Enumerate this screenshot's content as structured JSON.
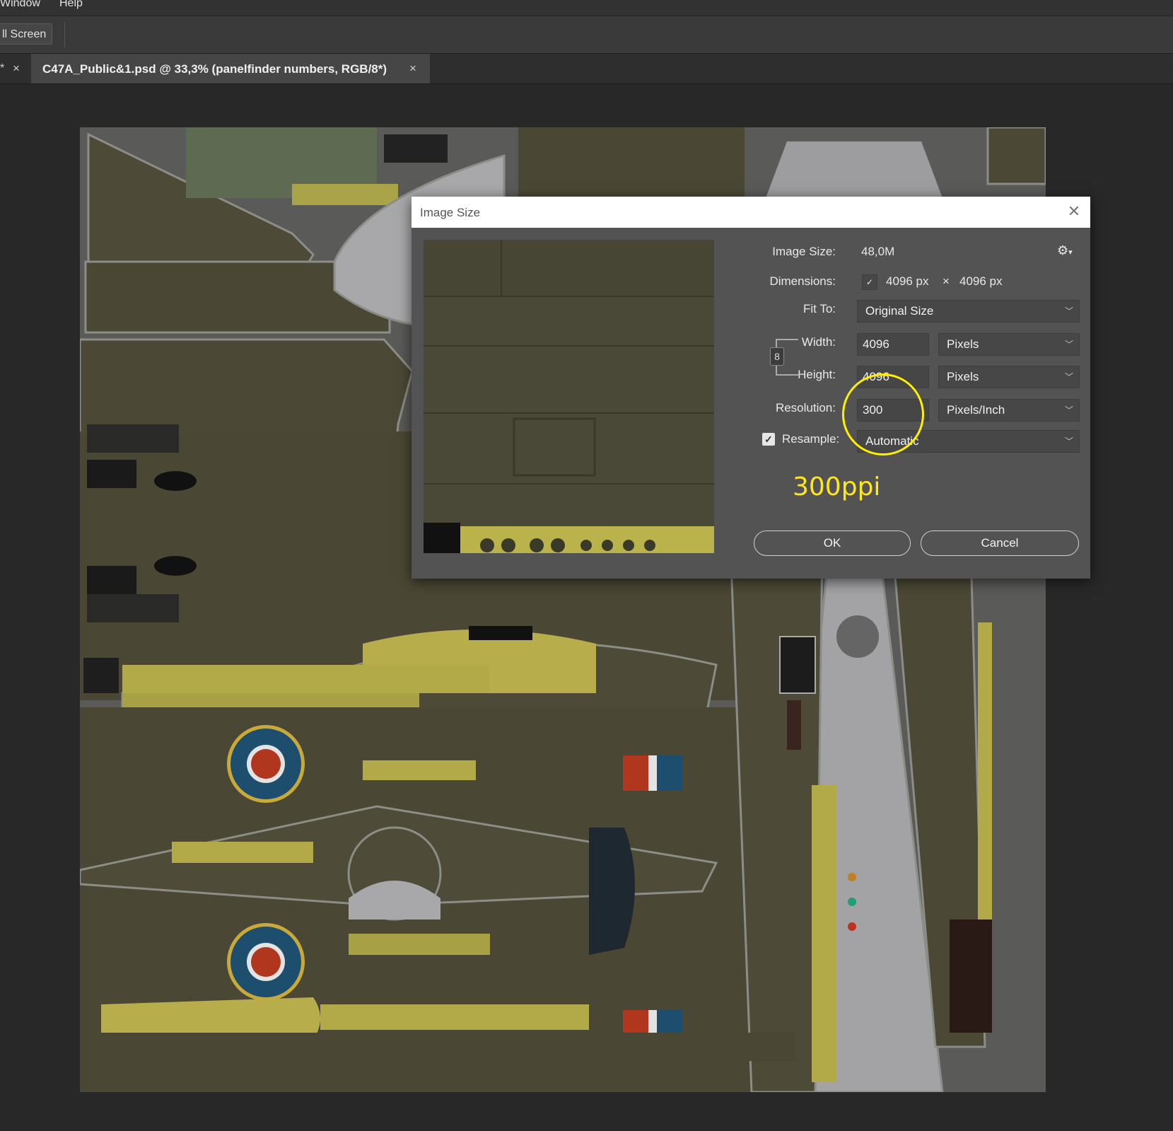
{
  "menu": {
    "items": [
      "Window",
      "Help"
    ]
  },
  "options_bar": {
    "full_screen_label": "ll Screen"
  },
  "tabs": {
    "prev_tab_marker": "*",
    "close_glyph": "×",
    "active_title": "C47A_Public&1.psd @ 33,3% (panelfinder numbers, RGB/8*)"
  },
  "dialog": {
    "title": "Image Size",
    "close_glyph": "✕",
    "image_size_label": "Image Size:",
    "image_size_value": "48,0M",
    "dimensions_label": "Dimensions:",
    "dimensions_width": "4096 px",
    "dimensions_times": "×",
    "dimensions_height": "4096 px",
    "fit_to_label": "Fit To:",
    "fit_to_value": "Original Size",
    "width_label": "Width:",
    "width_value": "4096",
    "width_unit": "Pixels",
    "height_label": "Height:",
    "height_value": "4096",
    "height_unit": "Pixels",
    "resolution_label": "Resolution:",
    "resolution_value": "300",
    "resolution_unit": "Pixels/Inch",
    "resample_label": "Resample:",
    "resample_checked": true,
    "resample_value": "Automatic",
    "ok_label": "OK",
    "cancel_label": "Cancel"
  },
  "annotation": {
    "text": "300ppi",
    "color": "#ffe81a"
  },
  "colors": {
    "app_bg": "#282828",
    "dialog_bg": "#535353",
    "texture_olive": "#4a4836",
    "texture_yellow": "#bab24a",
    "roundel_blue": "#1e4e6e",
    "roundel_red": "#b0361e"
  }
}
